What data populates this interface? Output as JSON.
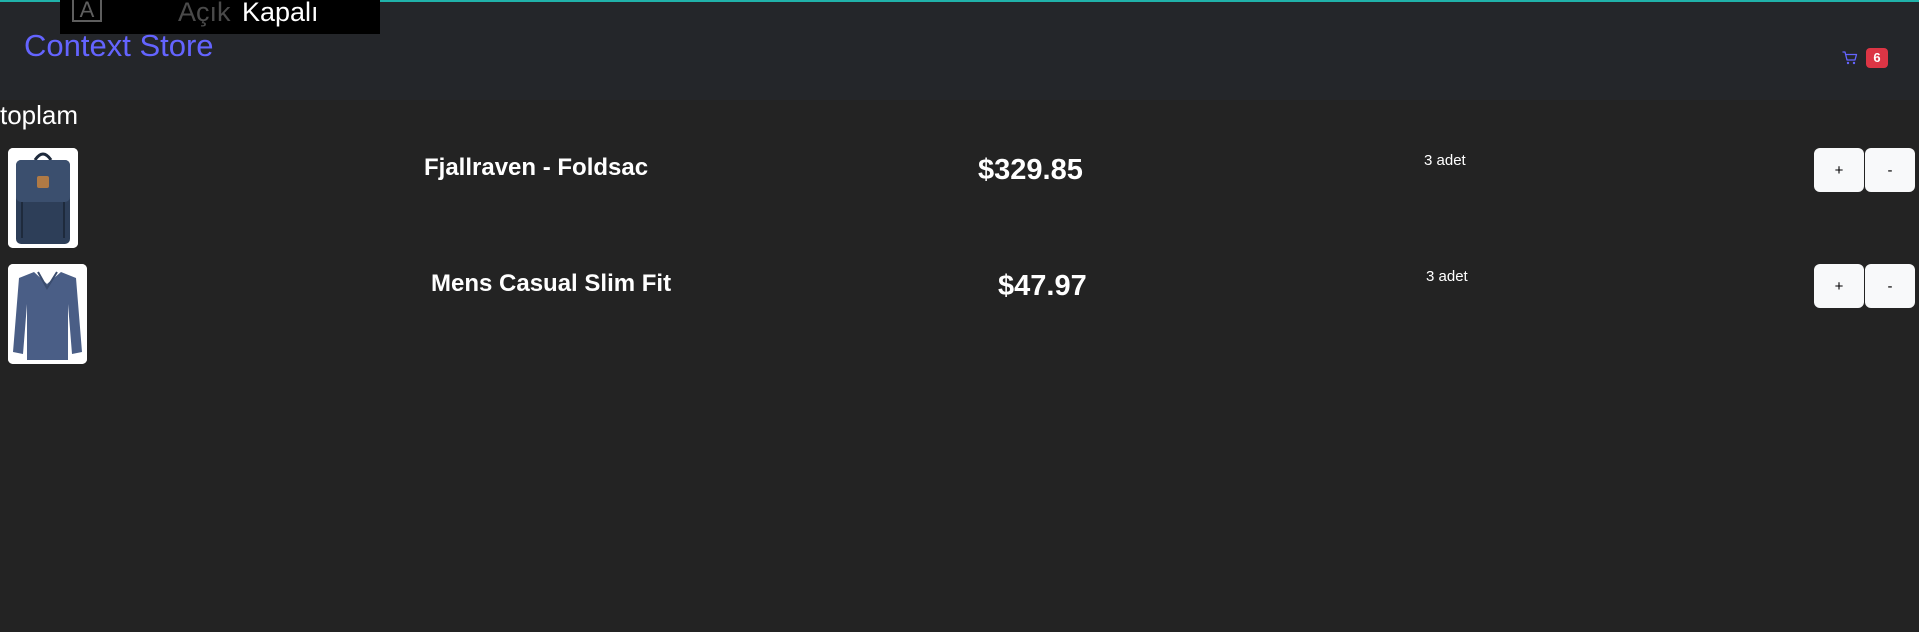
{
  "theme_toggle": {
    "icon": "A",
    "open_label": "Açık",
    "closed_label": "Kapalı"
  },
  "header": {
    "brand": "Context Store",
    "cart_icon": "cart-icon",
    "cart_count": "6"
  },
  "cart": {
    "total_label": "toplam",
    "items": [
      {
        "name": "Fjallraven - Foldsac",
        "price": "$329.85",
        "quantity": "3 adet",
        "plus_label": "+",
        "minus_label": "-",
        "image": "backpack-image"
      },
      {
        "name": "Mens Casual Slim Fit",
        "price": "$47.97",
        "quantity": "3 adet",
        "plus_label": "+",
        "minus_label": "-",
        "image": "tshirt-image"
      }
    ]
  },
  "colors": {
    "background": "#232323",
    "header_background": "#24262a",
    "brand": "#6464ff",
    "accent_line": "#20b2aa",
    "badge": "#dc3545",
    "button": "#f8f9fa"
  }
}
